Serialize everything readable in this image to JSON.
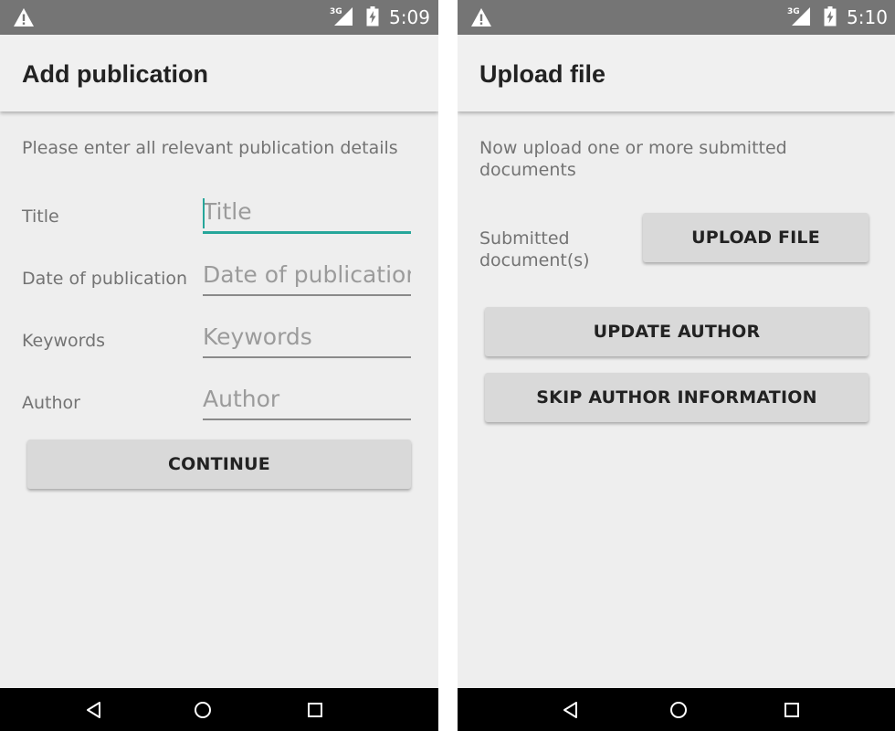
{
  "left_screen": {
    "status": {
      "time": "5:09",
      "network": "3G"
    },
    "app_bar": {
      "title": "Add publication"
    },
    "intro": "Please enter all relevant publication details",
    "form": {
      "title_label": "Title",
      "title_placeholder": "Title",
      "date_label": "Date of publication",
      "date_placeholder": "Date of publication",
      "keywords_label": "Keywords",
      "keywords_placeholder": "Keywords",
      "author_label": "Author",
      "author_placeholder": "Author"
    },
    "continue_label": "CONTINUE"
  },
  "right_screen": {
    "status": {
      "time": "5:10",
      "network": "3G"
    },
    "app_bar": {
      "title": "Upload file"
    },
    "intro": "Now upload one or more submitted documents",
    "submitted_label": "Submitted document(s)",
    "upload_label": "UPLOAD FILE",
    "update_author_label": "UPDATE AUTHOR",
    "skip_author_label": "SKIP AUTHOR INFORMATION"
  },
  "icons": {
    "warning": "warning-icon",
    "signal": "signal-icon",
    "battery": "battery-charging-icon",
    "back": "back-icon",
    "home": "home-icon",
    "recents": "recents-icon"
  },
  "colors": {
    "status_bar": "#757575",
    "accent": "#26a69a",
    "button": "#d9d9d9",
    "background": "#eeeeee"
  }
}
